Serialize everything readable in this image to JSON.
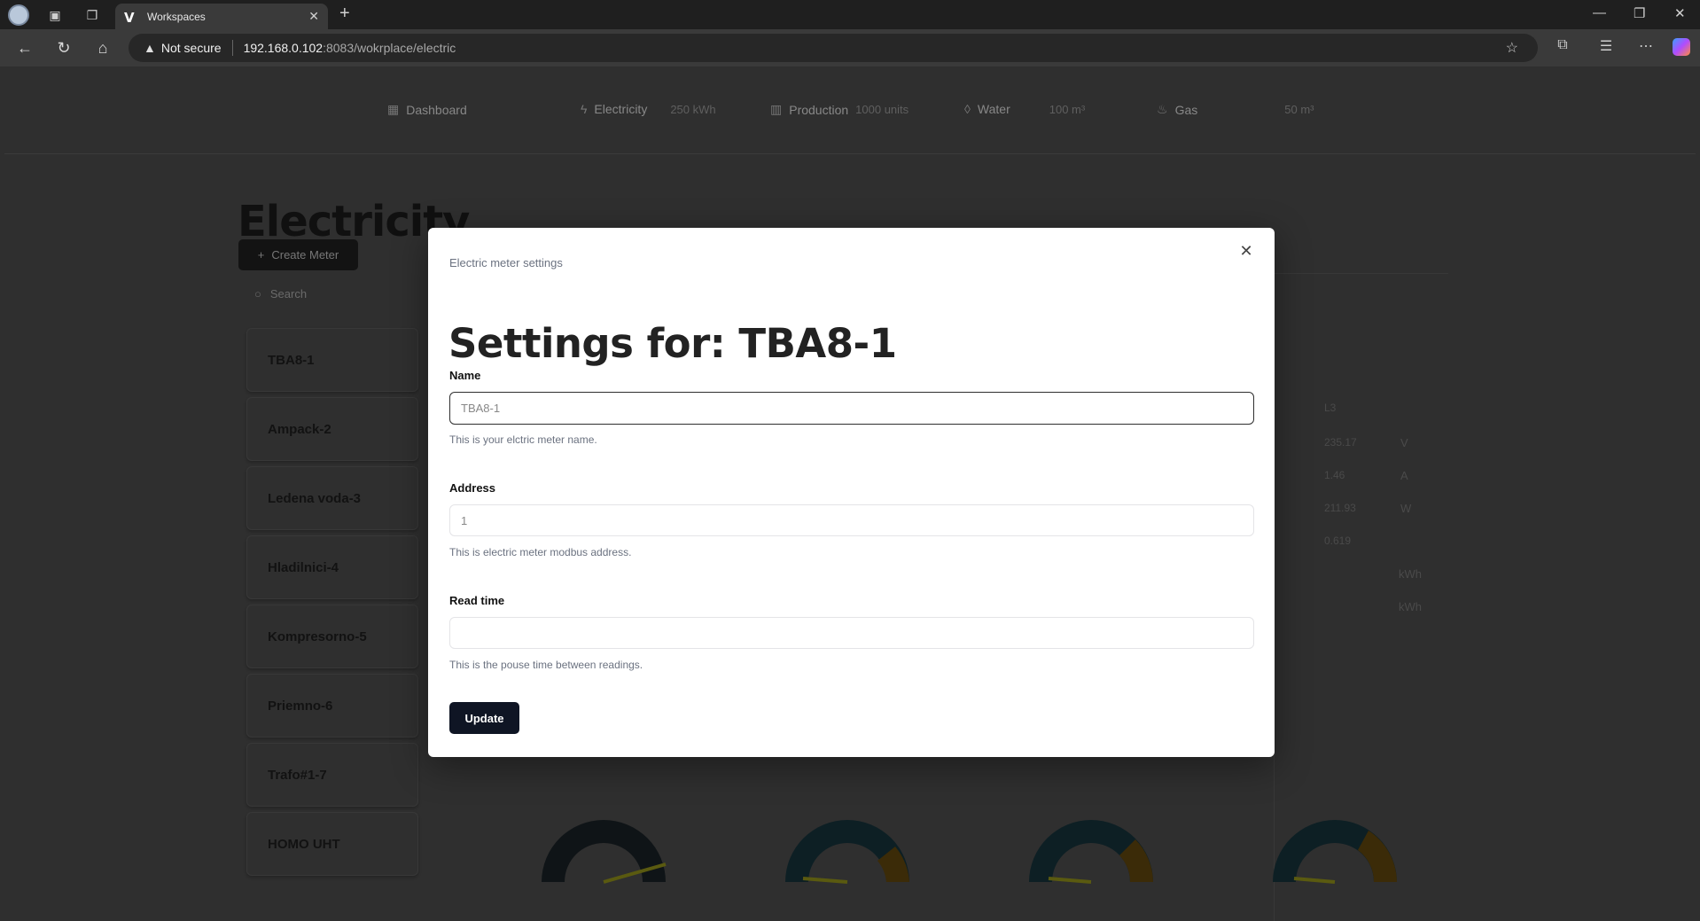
{
  "browser": {
    "tab_title": "Workspaces",
    "security_label": "Not secure",
    "url_host": "192.168.0.102",
    "url_path": ":8083/wokrplace/electric"
  },
  "topnav": {
    "items": [
      {
        "label": "Dashboard",
        "value": "",
        "icon": "grid-icon"
      },
      {
        "label": "Electricity",
        "value": "250 kWh",
        "icon": "bolt-icon"
      },
      {
        "label": "Production",
        "value": "1000 units",
        "icon": "factory-icon"
      },
      {
        "label": "Water",
        "value": "100 m³",
        "icon": "droplet-icon"
      },
      {
        "label": "Gas",
        "value": "50 m³",
        "icon": "flame-icon"
      }
    ]
  },
  "page": {
    "title": "Electricity",
    "create_button": "Create Meter",
    "search_placeholder": "Search"
  },
  "meters": [
    "TBA8-1",
    "Ampack-2",
    "Ledena voda-3",
    "Hladilnici-4",
    "Kompresorno-5",
    "Priemno-6",
    "Trafo#1-7",
    "HOMO UHT"
  ],
  "background_panel": {
    "column_header": "L3",
    "rows": [
      {
        "value": "235.17",
        "unit": "V"
      },
      {
        "value": "1.46",
        "unit": "A"
      },
      {
        "value": "211.93",
        "unit": "W"
      },
      {
        "value": "0.619",
        "unit": ""
      },
      {
        "value": "",
        "unit": "kWh"
      },
      {
        "value": "",
        "unit": "kWh"
      }
    ]
  },
  "modal": {
    "subtitle": "Electric meter settings",
    "title": "Settings for: TBA8-1",
    "fields": {
      "name": {
        "label": "Name",
        "value": "TBA8-1",
        "description": "This is your elctric meter name."
      },
      "address": {
        "label": "Address",
        "value": "1",
        "description": "This is electric meter modbus address."
      },
      "read_time": {
        "label": "Read time",
        "value": "",
        "description": "This is the pouse time between readings."
      }
    },
    "submit_label": "Update"
  },
  "colors": {
    "primary_button": "#0f1524",
    "overlay_bg": "#2f2f2f",
    "modal_bg": "#ffffff"
  }
}
